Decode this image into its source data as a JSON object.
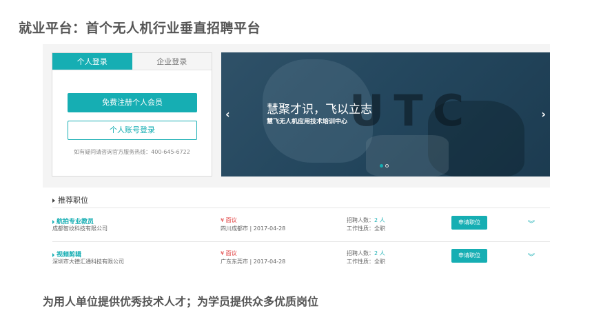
{
  "slide": {
    "title": "就业平台：首个无人机行业垂直招聘平台",
    "caption": "为用人单位提供优秀技术人才；为学员提供众多优质岗位"
  },
  "login": {
    "tabs": [
      {
        "label": "个人登录",
        "active": true
      },
      {
        "label": "企业登录",
        "active": false
      }
    ],
    "register_label": "免费注册个人会员",
    "login_label": "个人账号登录",
    "hotline": "如有疑问请咨询官方服务热线：400-645-6722"
  },
  "banner": {
    "headline": "慧聚才识，飞以立志",
    "sub": "慧飞无人机应用技术培训中心",
    "watermark": "UTC",
    "prev_glyph": "‹",
    "next_glyph": "›",
    "active_slide": 1,
    "slide_count": 2
  },
  "jobs": {
    "heading": "推荐职位",
    "rows": [
      {
        "title": "航拍专业教员",
        "company": "成都智纹科技有限公司",
        "salary": "¥ 面议",
        "location_date": "四川成都市 | 2017-04-28",
        "count_label": "招聘人数：",
        "count_value": "2 人",
        "nature": "工作性质：全职",
        "apply_label": "申请职位"
      },
      {
        "title": "视频剪辑",
        "company": "深圳市大德汇通科技有限公司",
        "salary": "¥ 面议",
        "location_date": "广东东莞市 | 2017-04-28",
        "count_label": "招聘人数：",
        "count_value": "2 人",
        "nature": "工作性质：全职",
        "apply_label": "申请职位"
      }
    ]
  },
  "colors": {
    "accent": "#16aeb3",
    "salary": "#e04040"
  }
}
